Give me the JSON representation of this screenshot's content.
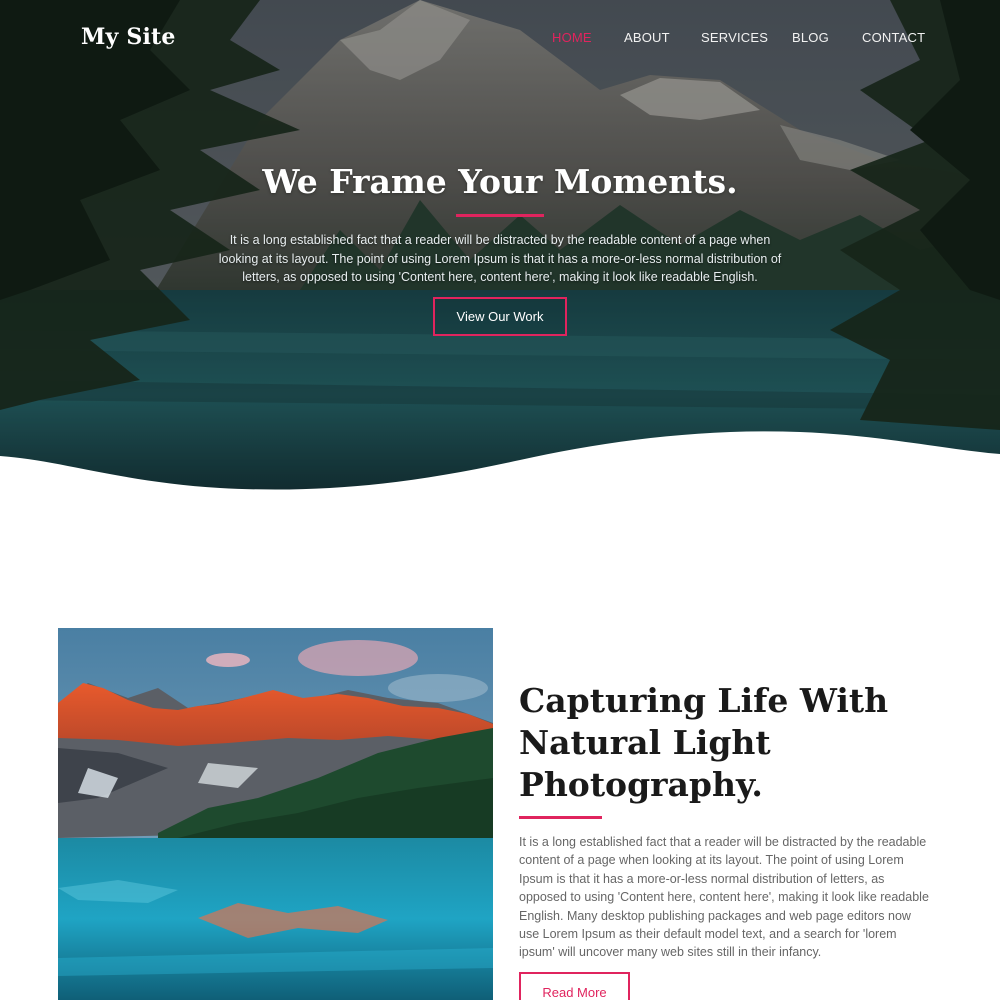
{
  "colors": {
    "accent": "#e0245e",
    "heading": "#1a1a1a",
    "body_text": "#666666",
    "background": "#ffffff"
  },
  "nav": {
    "brand": "My Site",
    "links": [
      "HOME",
      "ABOUT",
      "SERVICES",
      "BLOG",
      "CONTACT"
    ],
    "active": "HOME"
  },
  "hero": {
    "title": "We Frame Your Moments.",
    "text": "It is a long established fact that a reader will be distracted by the readable content of a page when looking at its layout. The point of using Lorem Ipsum is that it has a more-or-less normal distribution of letters, as opposed to using 'Content here, content here', making it look like readable English.",
    "button": "View Our Work"
  },
  "about": {
    "title": "Capturing Life With Natural Light Photography.",
    "text": "It is a long established fact that a reader will be distracted by the readable content of a page when looking at its layout. The point of using Lorem Ipsum is that it has a more-or-less normal distribution of letters, as opposed to using 'Content here, content here', making it look like readable English. Many desktop publishing packages and web page editors now use Lorem Ipsum as their default model text, and a search for 'lorem ipsum' will uncover many web sites still in their infancy.",
    "button": "Read More"
  }
}
